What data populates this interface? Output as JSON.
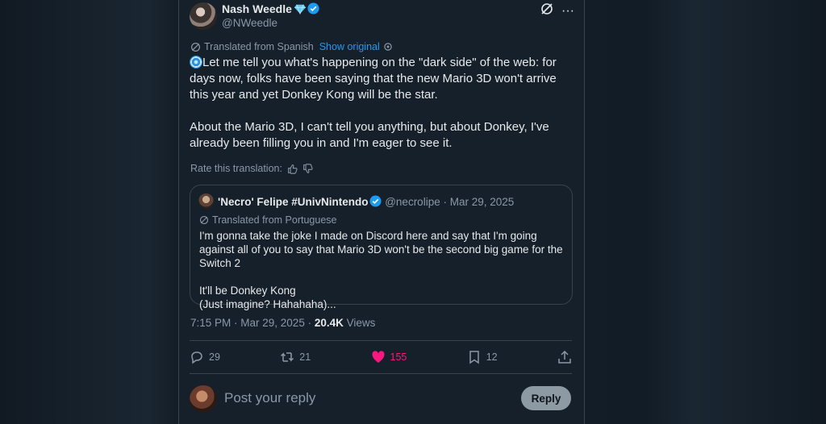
{
  "colors": {
    "background": "#15202b",
    "accent": "#1d9bf0",
    "like": "#f91880",
    "muted": "#8b98a5"
  },
  "author": {
    "name": "Nash Weedle",
    "handle": "@NWeedle",
    "badges": [
      "gem-icon",
      "verified-icon"
    ]
  },
  "translation": {
    "label": "Translated from Spanish",
    "show_original": "Show original",
    "rate_label": "Rate this translation:"
  },
  "tweet": {
    "text": "Let me tell you what's happening on the \"dark side\" of the web: for days now, folks have been saying that the new Mario 3D won't arrive this year and yet Donkey Kong will be the star.\n\nAbout the Mario 3D, I can't tell you anything, but about Donkey, I've already been filling you in and I'm eager to see it."
  },
  "quote": {
    "name": "'Necro' Felipe #UnivNintendo",
    "handle": "@necrolipe",
    "date": "· Mar 29, 2025",
    "translated_label": "Translated from Portuguese",
    "text": "I'm gonna take the joke I made on Discord here and say that I'm going against all of you to say that Mario 3D won't be the second big game for the Switch 2\n\nIt'll be Donkey Kong\n(Just imagine? Hahahaha)..."
  },
  "meta": {
    "time": "7:15 PM · Mar 29, 2025 · ",
    "views_count": "20.4K",
    "views_label": " Views"
  },
  "actions": {
    "replies": "29",
    "reposts": "21",
    "likes": "155",
    "bookmarks": "12"
  },
  "reply_box": {
    "placeholder": "Post your reply",
    "button_label": "Reply"
  }
}
